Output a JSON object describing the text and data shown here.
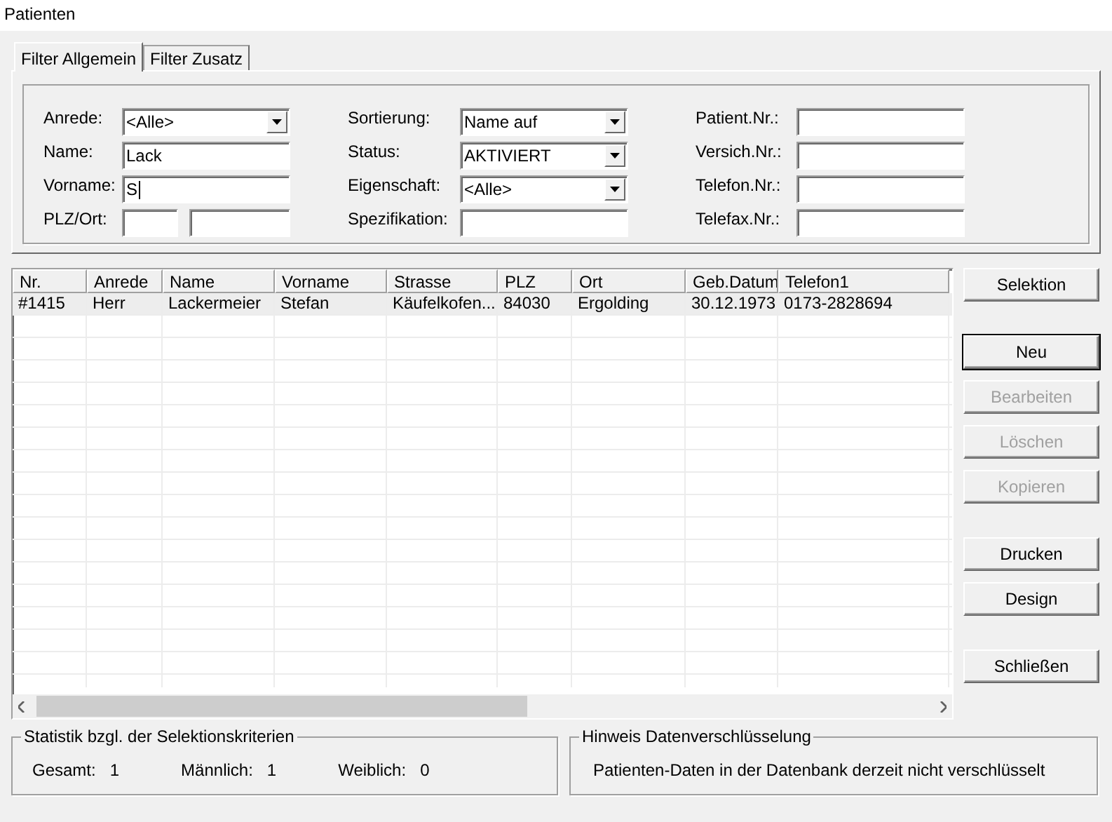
{
  "window": {
    "title": "Patienten"
  },
  "tabs": [
    {
      "label": "Filter Allgemein",
      "selected": true
    },
    {
      "label": "Filter Zusatz",
      "selected": false
    }
  ],
  "filter_columns": [
    [
      {
        "label": "Anrede:",
        "kind": "combo",
        "value": "<Alle>",
        "focused": false
      },
      {
        "label": "Name:",
        "kind": "text",
        "value": "Lack",
        "focused": false
      },
      {
        "label": "Vorname:",
        "kind": "text",
        "value": "S",
        "focused": true
      },
      {
        "label": "PLZ/Ort:",
        "kind": "split",
        "focused": false
      }
    ],
    [
      {
        "label": "Sortierung:",
        "kind": "combo",
        "value": "Name auf",
        "focused": false
      },
      {
        "label": "Status:",
        "kind": "combo",
        "value": "AKTIVIERT",
        "focused": false
      },
      {
        "label": "Eigenschaft:",
        "kind": "combo",
        "value": "<Alle>",
        "focused": false
      },
      {
        "label": "Spezifikation:",
        "kind": "text",
        "focused": false
      }
    ],
    [
      {
        "label": "Patient.Nr.:",
        "kind": "text",
        "focused": false
      },
      {
        "label": "Versich.Nr.:",
        "kind": "text",
        "focused": false
      },
      {
        "label": "Telefon.Nr.:",
        "kind": "text",
        "focused": false
      },
      {
        "label": "Telefax.Nr.:",
        "kind": "text",
        "focused": false
      }
    ]
  ],
  "table": {
    "columns": [
      "Nr.",
      "Anrede",
      "Name",
      "Vorname",
      "Strasse",
      "PLZ",
      "Ort",
      "Geb.Datum",
      "Telefon1"
    ],
    "rows": [
      {
        "selected": true,
        "cells": [
          "#1415",
          "Herr",
          "Lackermeier",
          "Stefan",
          "Käufelkofen...",
          "84030",
          "Ergolding",
          "30.12.1973",
          "0173-2828694"
        ]
      }
    ]
  },
  "button_groups": [
    [
      {
        "label": "Selektion",
        "disabled": false,
        "default": false
      }
    ],
    [
      {
        "label": "Neu",
        "disabled": false,
        "default": true
      },
      {
        "label": "Bearbeiten",
        "disabled": true,
        "default": false
      },
      {
        "label": "Löschen",
        "disabled": true,
        "default": false
      },
      {
        "label": "Kopieren",
        "disabled": true,
        "default": false
      }
    ],
    [
      {
        "label": "Drucken",
        "disabled": false,
        "default": false
      },
      {
        "label": "Design",
        "disabled": false,
        "default": false
      }
    ],
    [
      {
        "label": "Schließen",
        "disabled": false,
        "default": false
      }
    ]
  ],
  "statistics": {
    "title": "Statistik bzgl. der Selektionskriterien",
    "items": [
      {
        "label": "Gesamt:",
        "value": "1"
      },
      {
        "label": "Männlich:",
        "value": "1"
      },
      {
        "label": "Weiblich:",
        "value": "0"
      }
    ]
  },
  "encryption_notice": {
    "title": "Hinweis Datenverschlüsselung",
    "text": "Patienten-Daten in der Datenbank derzeit nicht verschlüsselt"
  }
}
